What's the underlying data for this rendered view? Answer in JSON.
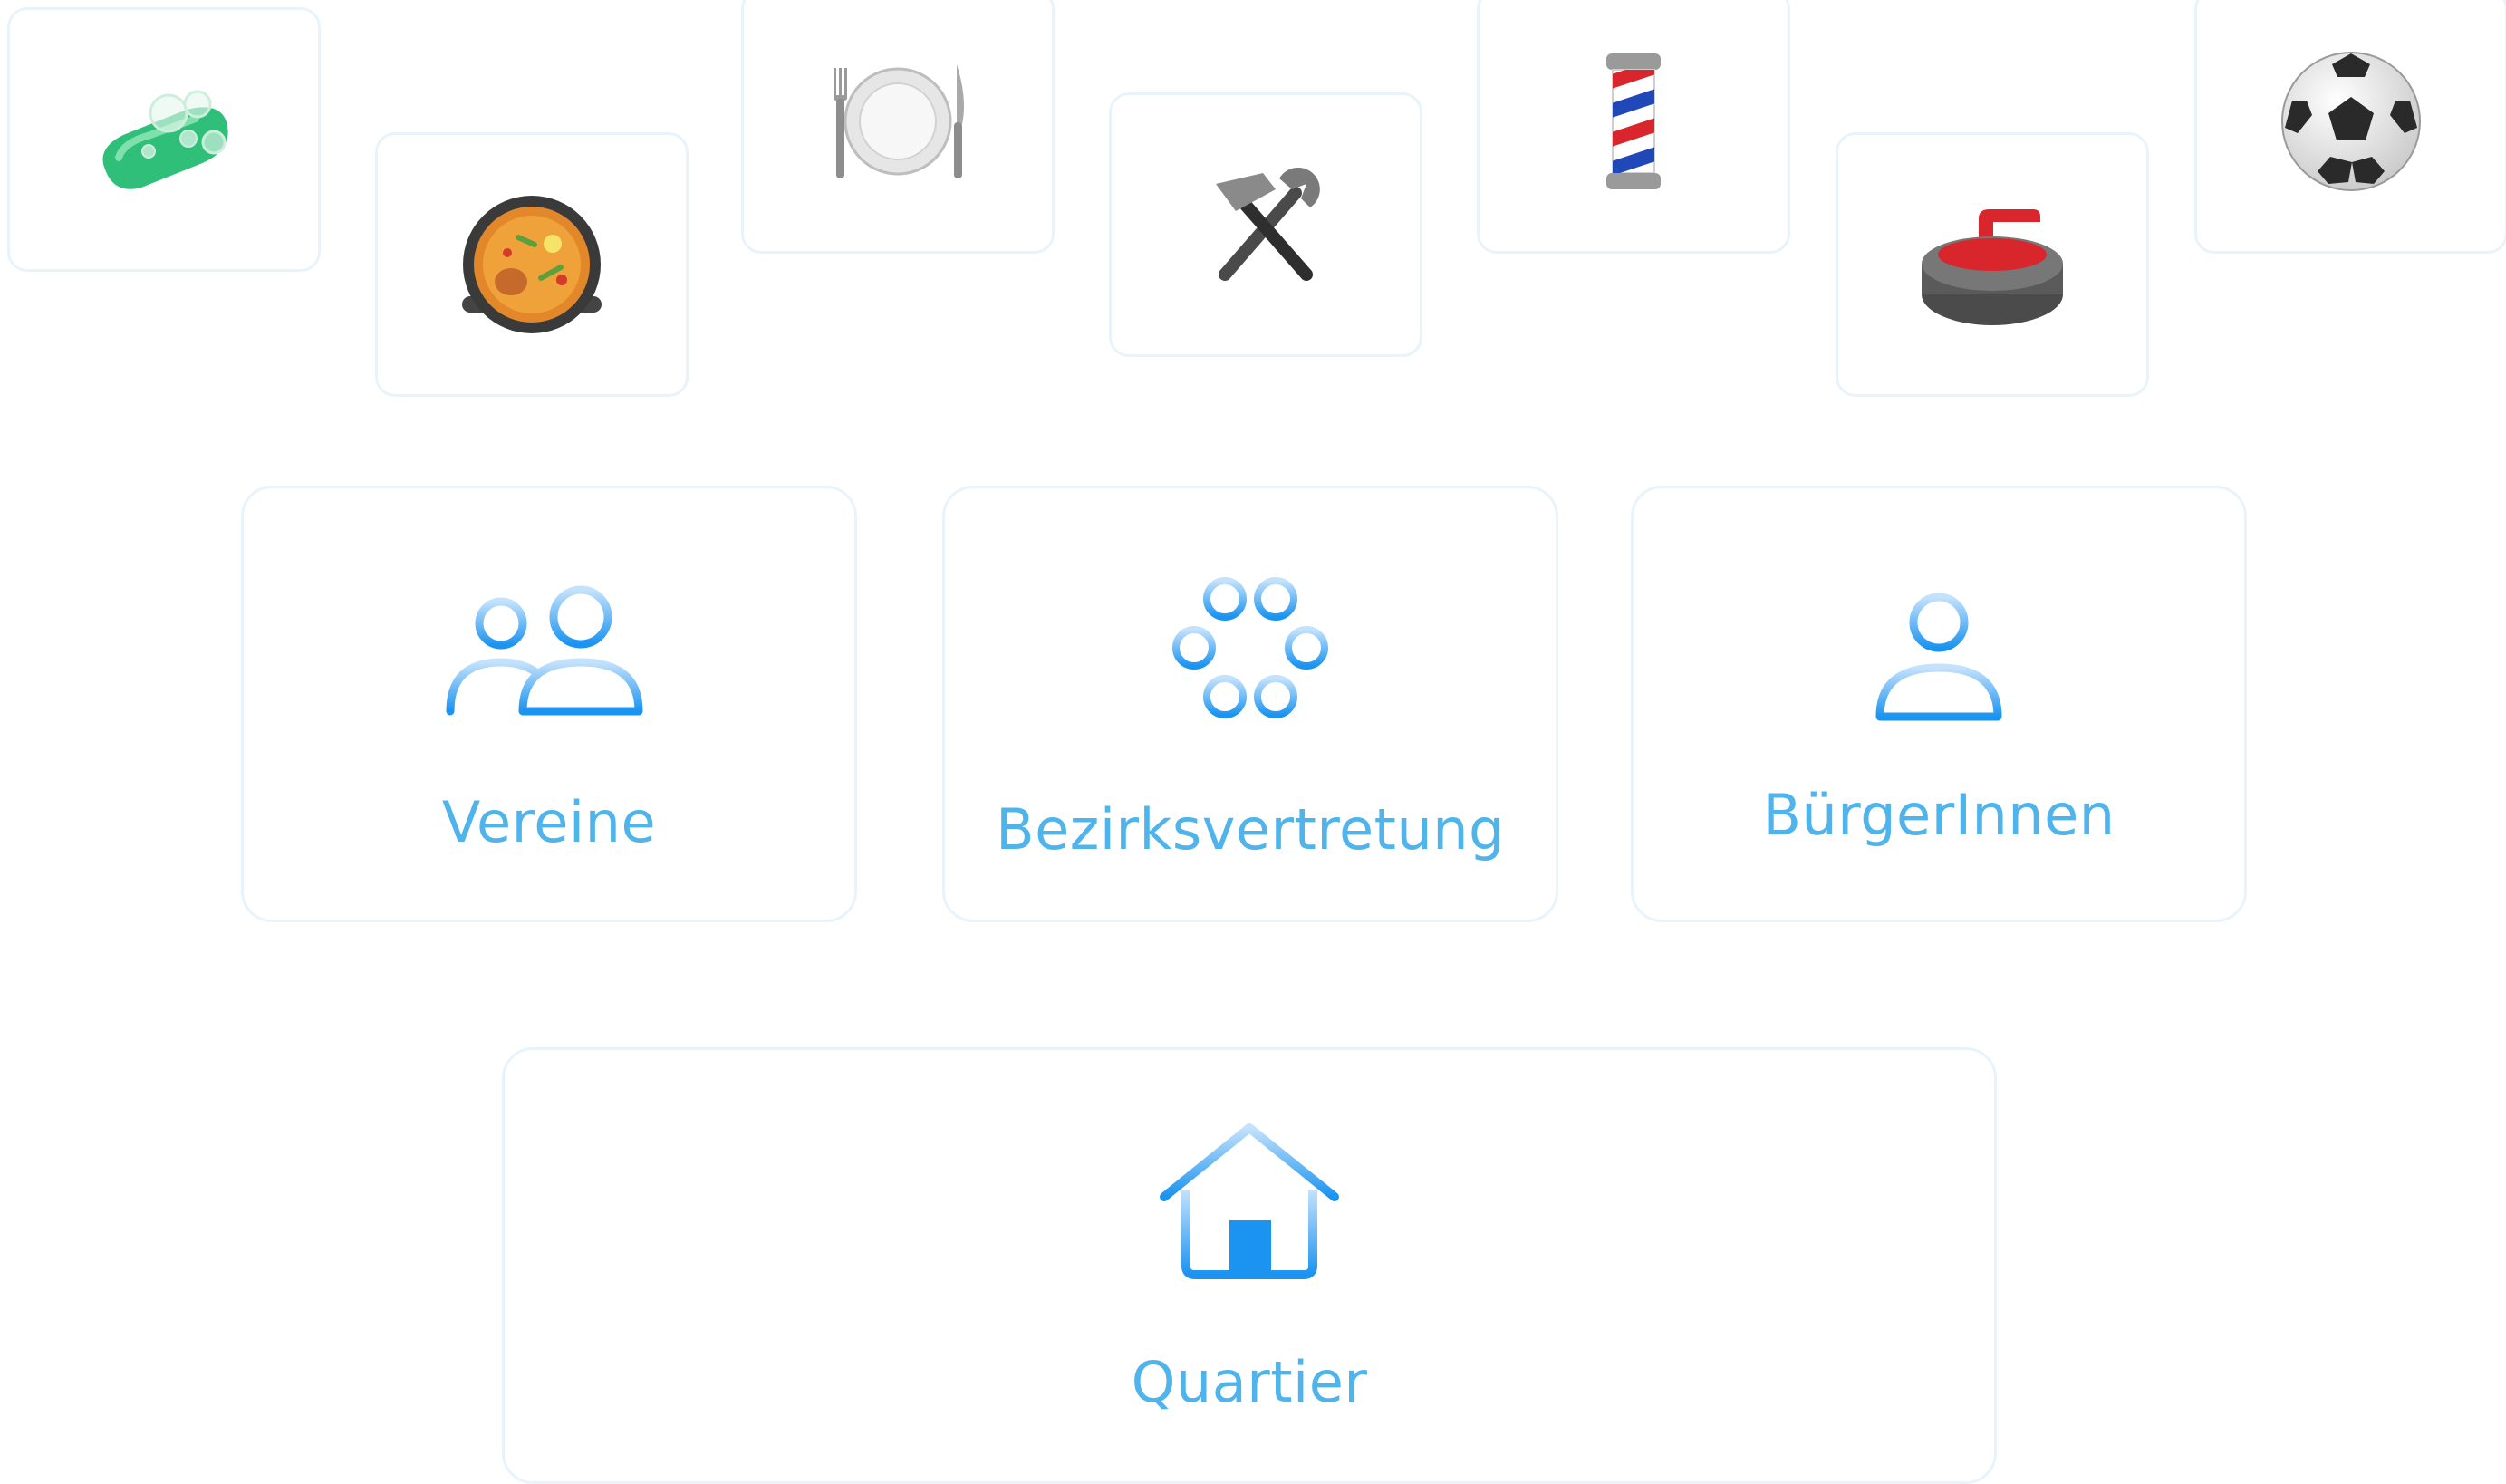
{
  "emoji_tiles": [
    {
      "icon": "soap-icon"
    },
    {
      "icon": "paella-pan-icon"
    },
    {
      "icon": "fork-knife-plate-icon"
    },
    {
      "icon": "hammer-wrench-icon"
    },
    {
      "icon": "barber-pole-icon"
    },
    {
      "icon": "curling-stone-icon"
    },
    {
      "icon": "soccer-ball-icon"
    }
  ],
  "cards": {
    "vereine": {
      "label": "Vereine",
      "icon": "two-people-icon"
    },
    "bezirksvertretung": {
      "label": "Bezirksvertretung",
      "icon": "circle-of-people-icon"
    },
    "buergerinnen": {
      "label": "BürgerInnen",
      "icon": "person-icon"
    },
    "quartier": {
      "label": "Quartier",
      "icon": "house-icon"
    }
  },
  "colors": {
    "accent": "#4fb4ec",
    "icon_light": "#b8dcfb",
    "icon_dark": "#1b93f0",
    "card_border": "#e8f3fc"
  }
}
